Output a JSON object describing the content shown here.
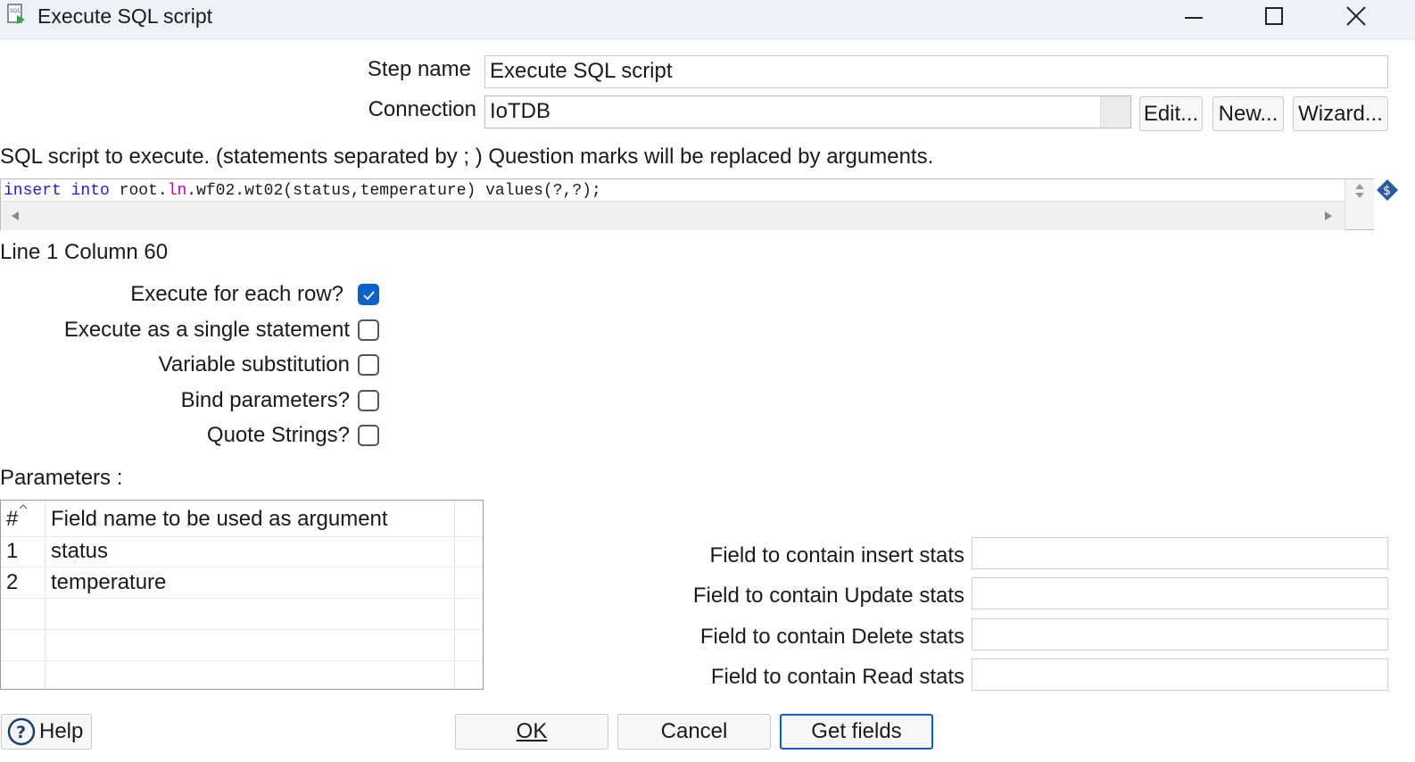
{
  "window": {
    "title": "Execute SQL script",
    "icon": "sql-script-icon",
    "controls": [
      "minimize-icon",
      "maximize-icon",
      "close-icon"
    ]
  },
  "form": {
    "step_name_label": "Step name",
    "step_name_value": "Execute SQL script",
    "connection_label": "Connection",
    "connection_value": "IoTDB",
    "edit_button": "Edit...",
    "new_button": "New...",
    "wizard_button": "Wizard...",
    "script_label": "SQL script to execute. (statements separated by ; ) Question marks will be replaced by arguments.",
    "script": {
      "kw_insert": "insert",
      "kw_into": "into",
      "part_root": " root.",
      "part_ln": "ln",
      "part_rest": ".wf02.wt02(status,temperature) values(?,?);"
    },
    "cursor_position": "Line 1 Column 60"
  },
  "options": [
    {
      "label": "Execute for each row?",
      "checked": true
    },
    {
      "label": "Execute as a single statement",
      "checked": false
    },
    {
      "label": "Variable substitution",
      "checked": false
    },
    {
      "label": "Bind parameters?",
      "checked": false
    },
    {
      "label": "Quote Strings?",
      "checked": false
    }
  ],
  "parameters": {
    "label": "Parameters :",
    "columns": [
      "#",
      "Field name to be used as argument"
    ],
    "rows": [
      {
        "num": "1",
        "field": "status"
      },
      {
        "num": "2",
        "field": "temperature"
      }
    ]
  },
  "stats": {
    "insert_label": "Field to contain insert stats",
    "update_label": "Field to contain Update stats",
    "delete_label": "Field to contain Delete stats",
    "read_label": "Field to contain Read stats",
    "insert_value": "",
    "update_value": "",
    "delete_value": "",
    "read_value": ""
  },
  "footer": {
    "help": "Help",
    "ok": "OK",
    "cancel": "Cancel",
    "get_fields": "Get fields"
  },
  "colors": {
    "accent": "#0b63c9",
    "keyword": "#1c1ce0",
    "token": "#c800c8",
    "titlebar": "#eef2f8"
  }
}
